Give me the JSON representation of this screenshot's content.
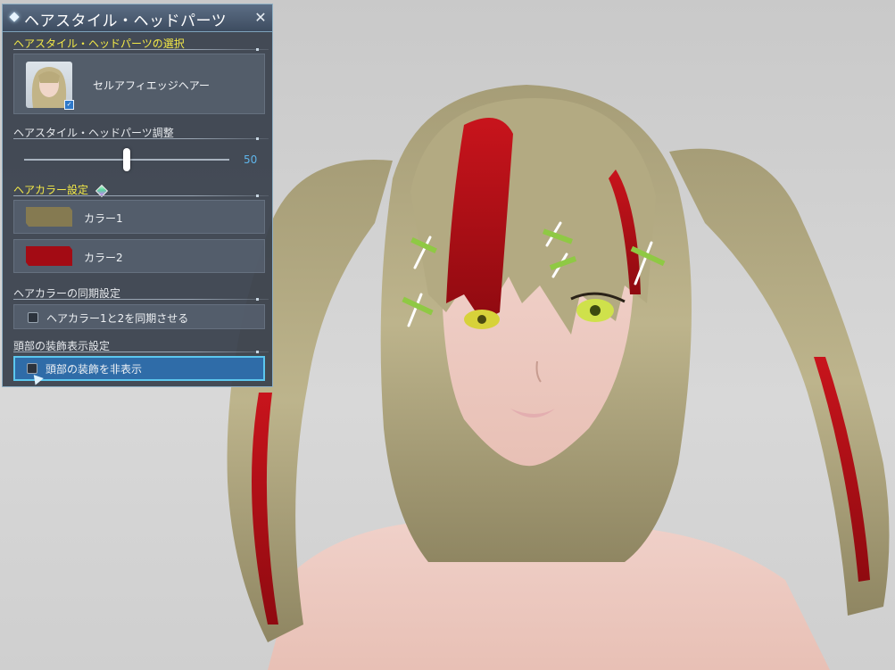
{
  "window": {
    "title": "ヘアスタイル・ヘッドパーツ",
    "close_label": "✕"
  },
  "sections": {
    "hair_select_header": "ヘアスタイル・ヘッドパーツの選択",
    "hair_adjust_header": "ヘアスタイル・ヘッドパーツ調整",
    "hair_color_header": "ヘアカラー設定",
    "color_sync_header": "ヘアカラーの同期設定",
    "head_decor_header": "頭部の装飾表示設定"
  },
  "hairstyle": {
    "name": "セルアフィエッジヘアー",
    "badge": "✓"
  },
  "adjust_slider": {
    "value": 50,
    "value_label": "50",
    "min": 0,
    "max": 100
  },
  "colors": [
    {
      "label": "カラー1",
      "hex": "#857a51"
    },
    {
      "label": "カラー2",
      "hex": "#a30b14"
    }
  ],
  "sync_option": {
    "label": "ヘアカラー1と2を同期させる",
    "checked": false
  },
  "head_decor_option": {
    "label": "頭部の装飾を非表示",
    "checked": false,
    "selected": true
  },
  "theme": {
    "header_accent": "#f4ea47",
    "value_accent": "#5fb5ea",
    "selection_bg": "#2f6ca8",
    "selection_border": "#5cc7ee"
  }
}
